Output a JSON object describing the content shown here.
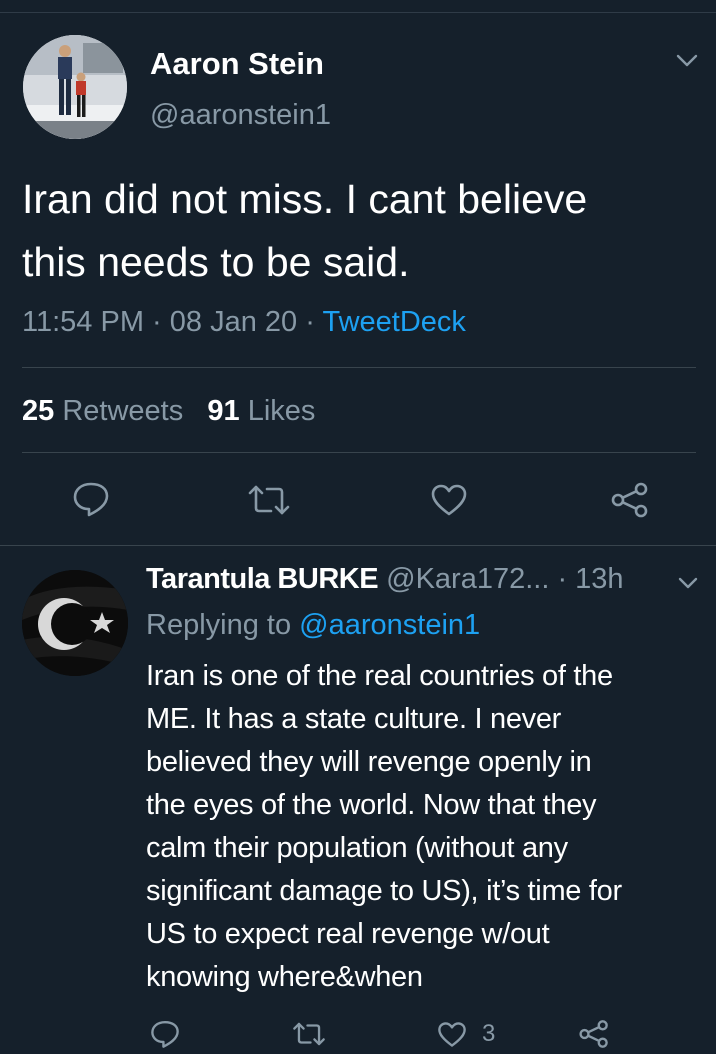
{
  "main_tweet": {
    "author_name": "Aaron Stein",
    "author_handle": "@aaronstein1",
    "text_line1": "Iran did not miss. I cant believe",
    "text_line2": "this needs to be said.",
    "time": "11:54 PM",
    "date": "08 Jan 20",
    "separator": "·",
    "source": "TweetDeck",
    "retweet_count": "25",
    "retweet_label": "Retweets",
    "like_count": "91",
    "like_label": "Likes"
  },
  "reply": {
    "author_name": "Tarantula BURKE",
    "author_handle": "@Kara172...",
    "time_ago": "· 13h",
    "replying_prefix": "Replying to",
    "replying_mention": "@aaronstein1",
    "text_lines": [
      "Iran is one of the real countries of the",
      "ME. It has a state culture. I never",
      "believed they will revenge openly in",
      "the eyes of the world. Now that they",
      "calm their population (without any",
      "significant damage to US), it’s time for",
      "US to expect real revenge w/out",
      "knowing where&when"
    ],
    "like_count": "3"
  },
  "icons": {
    "reply": "reply-icon",
    "retweet": "retweet-icon",
    "like": "heart-icon",
    "share": "share-icon",
    "menu": "chevron-down-icon"
  },
  "colors": {
    "background": "#15202b",
    "text": "#ffffff",
    "secondary_text": "#8899a6",
    "link": "#1da1f2",
    "divider": "#38444d"
  }
}
